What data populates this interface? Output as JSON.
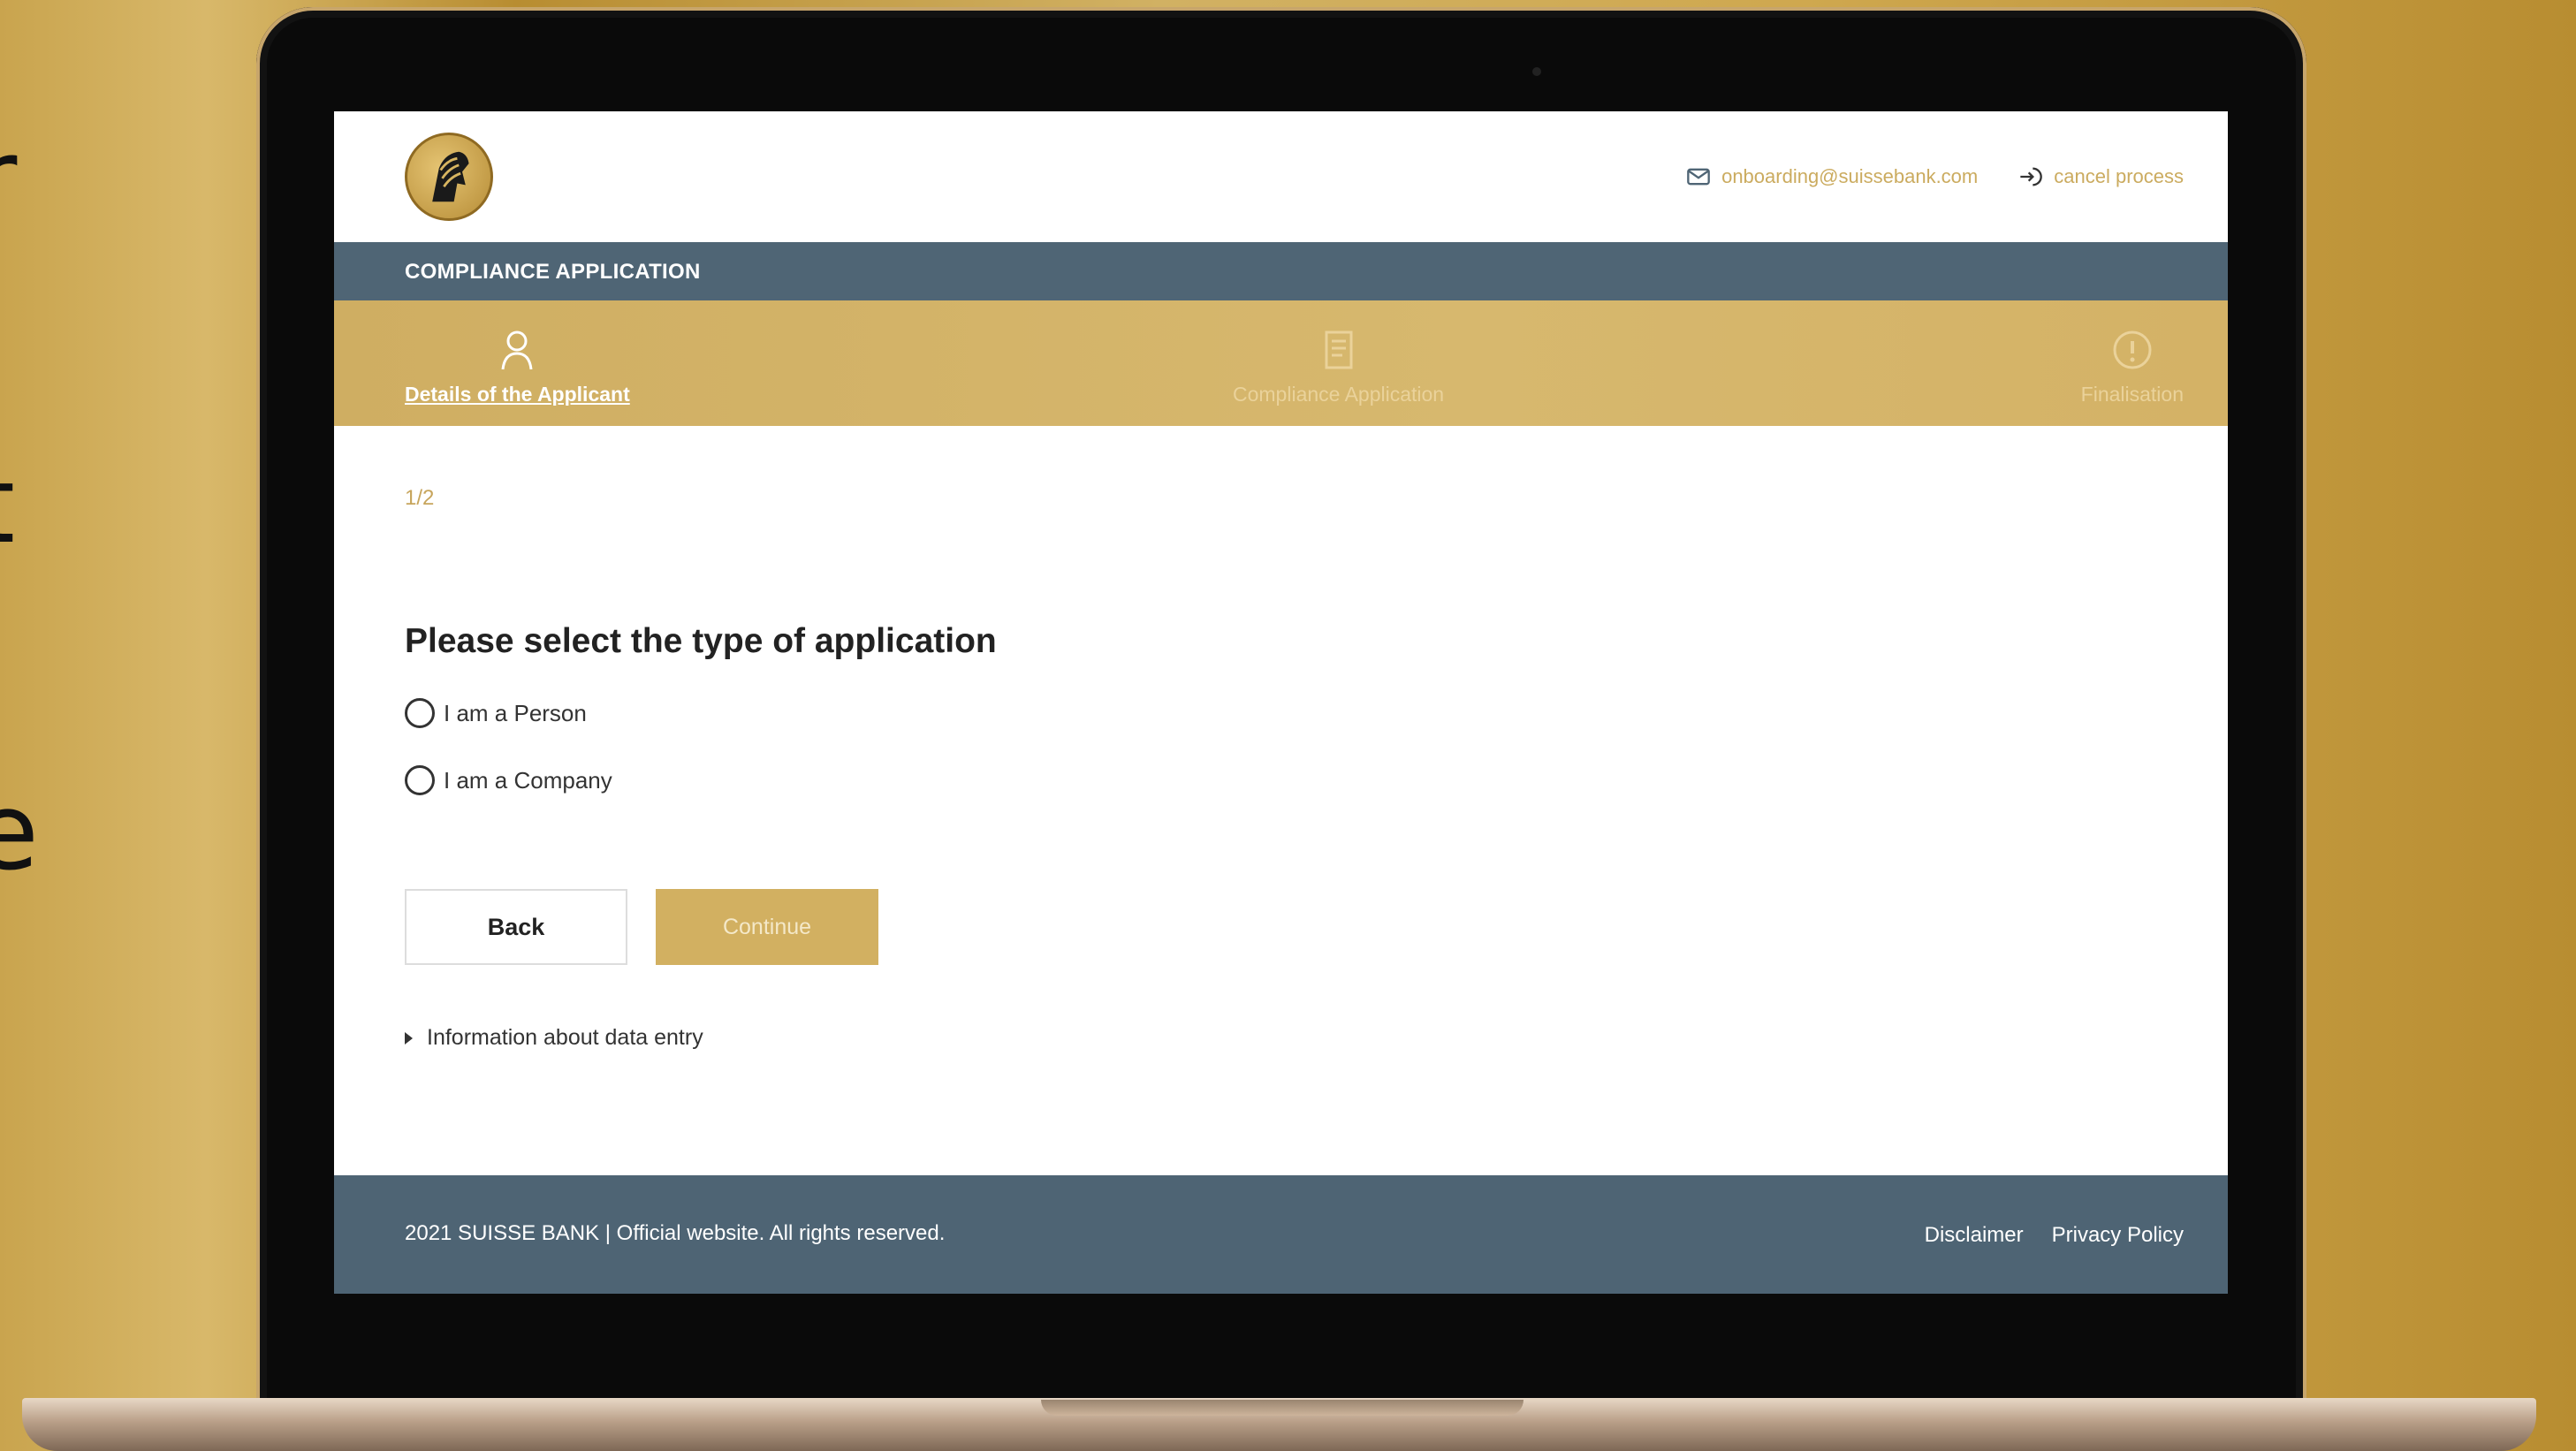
{
  "background": {
    "side_letters": [
      "r",
      ".",
      "t",
      "",
      "e"
    ]
  },
  "header": {
    "logo_icon": "horse-head-logo",
    "email": "onboarding@suissebank.com",
    "email_icon": "envelope-icon",
    "cancel_label": "cancel process",
    "cancel_icon": "exit-icon"
  },
  "titlebar": {
    "title": "COMPLIANCE APPLICATION"
  },
  "steps": [
    {
      "label": "Details of the Applicant",
      "icon": "person-icon",
      "active": true
    },
    {
      "label": "Compliance Application",
      "icon": "document-icon",
      "active": false
    },
    {
      "label": "Finalisation",
      "icon": "info-icon",
      "active": false
    }
  ],
  "form": {
    "progress": "1/2",
    "question": "Please select the type of application",
    "options": [
      {
        "label": "I am a Person",
        "selected": false
      },
      {
        "label": "I am a Company",
        "selected": false
      }
    ],
    "back_label": "Back",
    "continue_label": "Continue",
    "info_toggle": "Information about data entry"
  },
  "footer": {
    "copyright": "2021 SUISSE BANK | Official website. All rights reserved.",
    "links": [
      "Disclaimer",
      "Privacy Policy"
    ]
  },
  "colors": {
    "gold": "#d2b061",
    "slate": "#4f6575",
    "text": "#222222"
  }
}
